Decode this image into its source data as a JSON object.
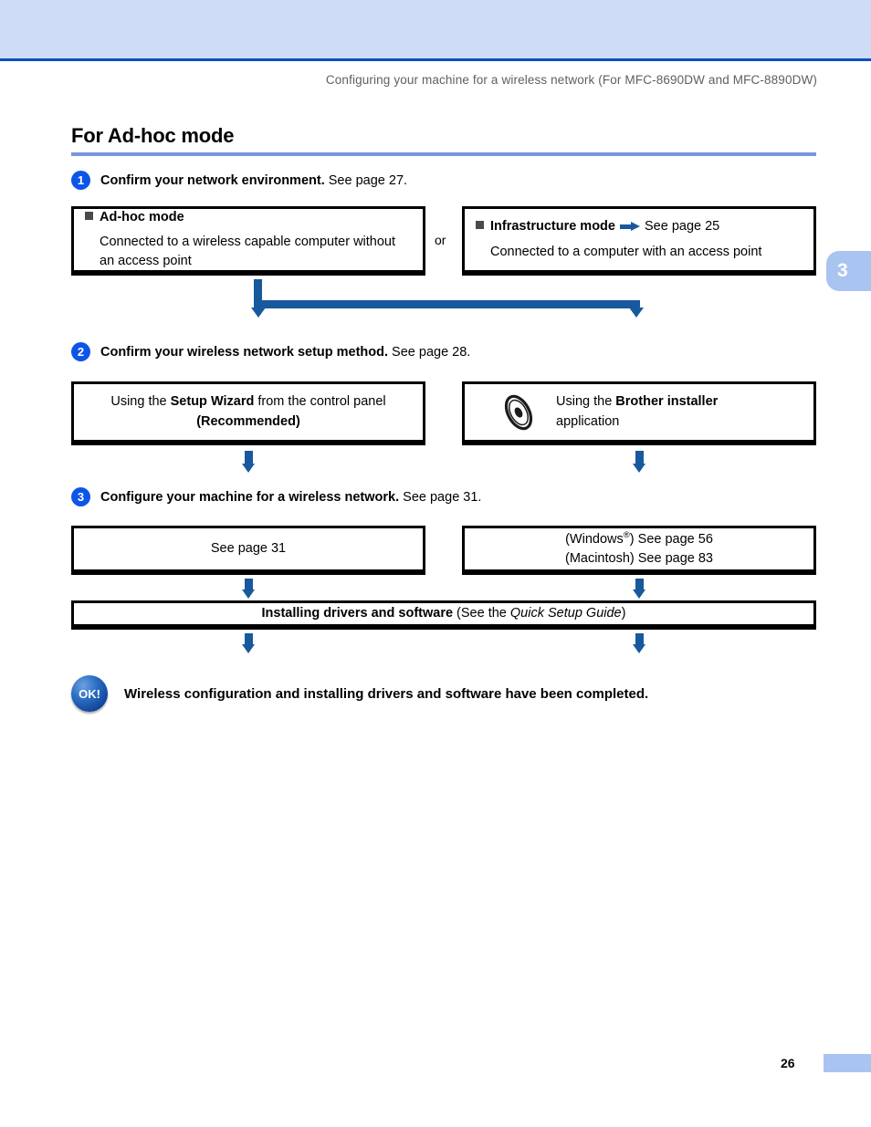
{
  "header": {
    "running_head": "Configuring your machine for a wireless network (For MFC-8690DW and MFC-8890DW)",
    "chapter_tab": "3",
    "band_color": "#cfdcf8",
    "rule_color": "#0b4fc0"
  },
  "section": {
    "title": "For Ad-hoc mode",
    "rule_color": "#7896dd"
  },
  "steps": [
    {
      "number": "1",
      "bold": "Confirm your network environment.",
      "rest": " See page 27."
    },
    {
      "number": "2",
      "bold": "Confirm your wireless network setup method.",
      "rest": " See page 28."
    },
    {
      "number": "3",
      "bold": "Configure your machine for a wireless network.",
      "rest": " See page 31."
    }
  ],
  "row1": {
    "left_box": {
      "heading": "Ad-hoc mode",
      "body": "Connected to a wireless capable computer without an access point"
    },
    "or": "or",
    "right_box": {
      "heading": "Infrastructure mode",
      "arrow_icon": "right-arrow-icon",
      "reference": "See page 25",
      "body": "Connected to a computer with an access point"
    }
  },
  "row2": {
    "left_box": {
      "line1_pre": "Using the ",
      "line1_bold": "Setup Wizard",
      "line1_post": " from the control panel",
      "line2_bold": "(Recommended)"
    },
    "right_box": {
      "cd_icon": "cd-disc-icon",
      "line1_pre": "Using the ",
      "line1_bold": "Brother installer",
      "line2": "application"
    }
  },
  "row3": {
    "left_box": {
      "text": "See page 31"
    },
    "right_box": {
      "line1_pre": "(Windows",
      "line1_sup": "®",
      "line1_post": ") See page 56",
      "line2": "(Macintosh) See page 83"
    }
  },
  "install_box": {
    "bold": "Installing drivers and software",
    "mid": " (See the ",
    "italic": "Quick Setup Guide",
    "end": ")"
  },
  "completion": {
    "badge_label": "OK!",
    "text": "Wireless configuration and installing drivers and software have been completed."
  },
  "footer": {
    "page_number": "26",
    "block_color": "#aac4f2"
  },
  "colors": {
    "arrow_blue": "#17599c",
    "step_badge_blue": "#0d55e8",
    "box_border": "#000000",
    "bullet_gray": "#4a4a4a"
  }
}
